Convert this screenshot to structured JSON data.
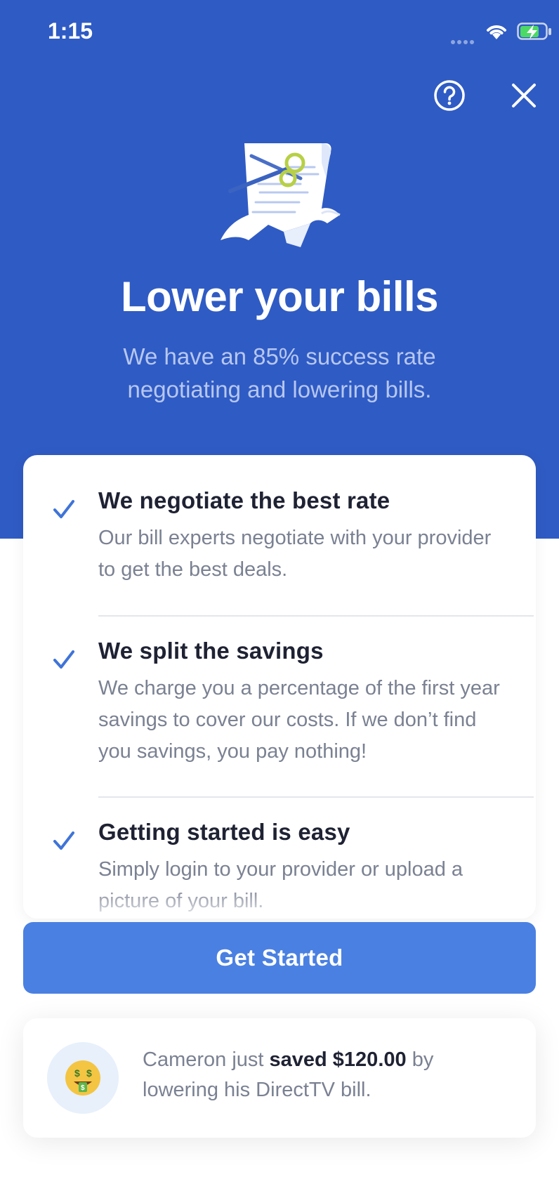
{
  "status_bar": {
    "time": "1:15"
  },
  "header": {
    "help_icon": "question-circle-icon",
    "close_icon": "close-icon",
    "title": "Lower your bills",
    "subtitle": "We have an 85% success rate negotiating and lowering bills."
  },
  "features": [
    {
      "title": "We negotiate the best rate",
      "description": "Our bill experts negotiate with your provider to get the best deals."
    },
    {
      "title": "We split the savings",
      "description": "We charge you a percentage of the first year savings to cover our costs. If we don’t find you savings, you pay nothing!"
    },
    {
      "title": "Getting started is easy",
      "description": "Simply login to your provider or upload a picture of your bill."
    }
  ],
  "cta": {
    "label": "Get Started"
  },
  "social_proof": {
    "name_prefix": "Cameron just ",
    "amount": "saved $120.00",
    "suffix": " by lowering his DirectTV bill.",
    "avatar_icon": "money-mouth-face-icon"
  },
  "colors": {
    "hero_blue": "#2f5bc4",
    "button_blue": "#4a80e2",
    "check_blue": "#3f74d8",
    "title_dark": "#1e2233",
    "body_gray": "#7a8192"
  }
}
